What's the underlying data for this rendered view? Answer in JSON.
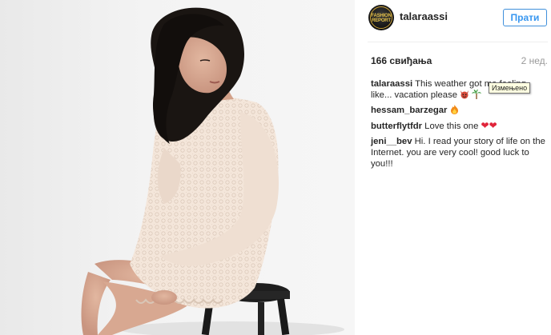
{
  "post": {
    "author": "talaraassi",
    "avatar_text": "FASHION REPORT",
    "follow_label": "Прати",
    "likes": "166 свиђања",
    "time_ago": "2 нед.",
    "tooltip": "Измењено"
  },
  "comments": [
    {
      "author": "talaraassi",
      "text": "This weather got me feeling like... vacation please",
      "emoji": [
        "devil-icon",
        "palm-tree-icon"
      ]
    },
    {
      "author": "hessam_barzegar",
      "text": "",
      "emoji": [
        "fire-icon"
      ]
    },
    {
      "author": "butterflytfdr",
      "text": "Love this one",
      "emoji": [
        "heart-icon",
        "heart-icon"
      ]
    },
    {
      "author": "jeni__bev",
      "text": "Hi. I read your story of life on the Internet. you are very cool! good luck to you!!!",
      "emoji": []
    }
  ],
  "colors": {
    "accent": "#3897f0",
    "heart": "#e0243a",
    "dress": "#f3e4d8"
  }
}
